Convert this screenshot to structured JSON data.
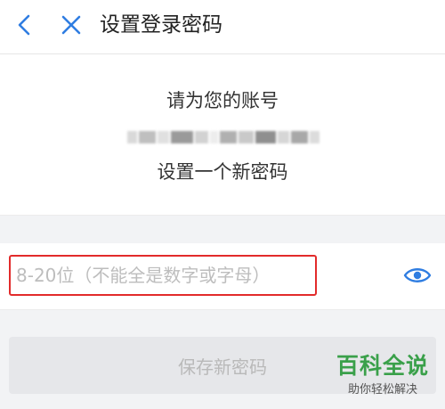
{
  "header": {
    "title": "设置登录密码",
    "back_icon": "chevron-left-icon",
    "close_icon": "close-icon",
    "accent": "#2f7de1"
  },
  "info": {
    "line1": "请为您的账号",
    "line2": "设置一个新密码"
  },
  "password": {
    "placeholder": "8-20位（不能全是数字或字母）",
    "value": "",
    "toggle_icon": "eye-icon"
  },
  "save": {
    "label": "保存新密码"
  },
  "watermark": {
    "main": "百科全说",
    "sub": "助你轻松解决"
  }
}
